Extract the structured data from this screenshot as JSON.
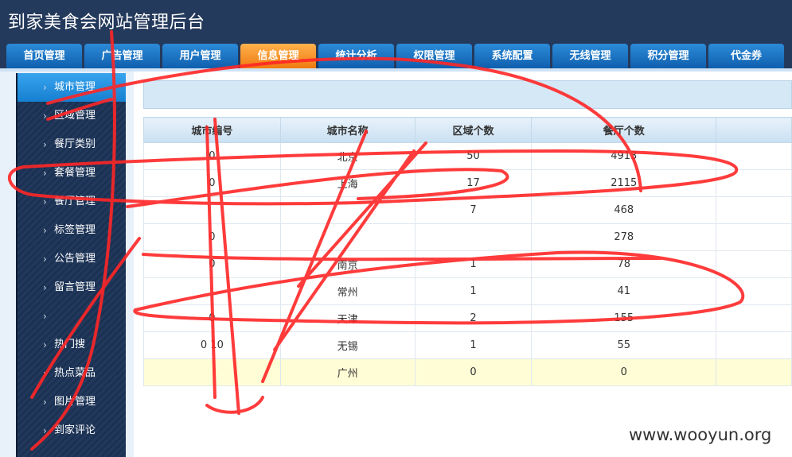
{
  "app": {
    "title": "到家美食会网站管理后台"
  },
  "nav_tabs": [
    {
      "label": "首页管理"
    },
    {
      "label": "广告管理"
    },
    {
      "label": "用户管理"
    },
    {
      "label": "信息管理"
    },
    {
      "label": "统计分析"
    },
    {
      "label": "权限管理"
    },
    {
      "label": "系统配置"
    },
    {
      "label": "无线管理"
    },
    {
      "label": "积分管理"
    },
    {
      "label": "代金券"
    }
  ],
  "active_tab": "信息管理",
  "sidebar": {
    "items": [
      {
        "label": "城市管理"
      },
      {
        "label": "区域管理"
      },
      {
        "label": "餐厅类别"
      },
      {
        "label": "套餐管理"
      },
      {
        "label": "餐厅管理"
      },
      {
        "label": "标签管理"
      },
      {
        "label": "公告管理"
      },
      {
        "label": "留言管理"
      },
      {
        "label": ""
      },
      {
        "label": "热门搜"
      },
      {
        "label": "热点菜品"
      },
      {
        "label": "图片管理"
      },
      {
        "label": "到家评论"
      },
      {
        "label": ""
      }
    ],
    "chevron_icon": "chevron-right-icon"
  },
  "table": {
    "headers": [
      "城市编号",
      "城市名称",
      "区域个数",
      "餐厅个数",
      ""
    ],
    "rows": [
      [
        "0",
        "北京",
        "50",
        "4913",
        ""
      ],
      [
        "0",
        "上海",
        "17",
        "2115",
        ""
      ],
      [
        "",
        "",
        "7",
        "468",
        ""
      ],
      [
        "0",
        "",
        "",
        "278",
        ""
      ],
      [
        "0",
        "南京",
        "1",
        "78",
        ""
      ],
      [
        "",
        "常州",
        "1",
        "41",
        ""
      ],
      [
        "0",
        "天津",
        "2",
        "155",
        ""
      ],
      [
        "0 10",
        "无锡",
        "1",
        "55",
        ""
      ],
      [
        "",
        "广州",
        "0",
        "0",
        ""
      ]
    ]
  },
  "watermark": "www.wooyun.org",
  "colors": {
    "header_bg": "#243a5c",
    "tab_blue": "#1f74c6",
    "tab_active": "#f7931e",
    "sidebar_bg": "#1e3558",
    "highlight_row": "#fffdd6",
    "scribble": "#ff2020"
  }
}
